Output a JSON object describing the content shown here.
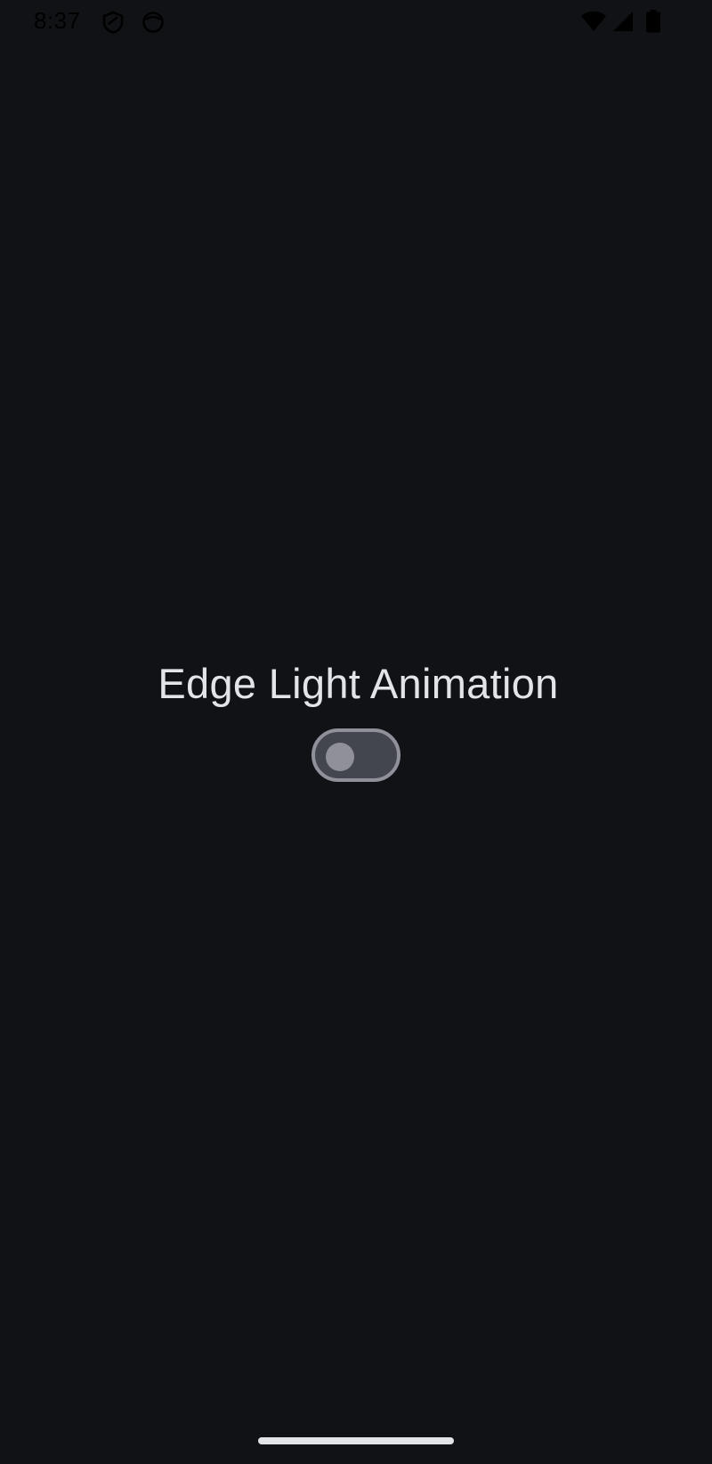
{
  "status_bar": {
    "time": "8:37",
    "left_icons": [
      "shield-icon",
      "face-icon"
    ],
    "right_icons": [
      "wifi-icon",
      "cellular-signal-icon",
      "battery-icon"
    ]
  },
  "main": {
    "title": "Edge Light Animation",
    "toggle": {
      "state": "off"
    }
  },
  "colors": {
    "background": "#111216",
    "text": "#e3e3ea",
    "toggle_track": "#44464f",
    "toggle_outline": "#8f909a"
  }
}
